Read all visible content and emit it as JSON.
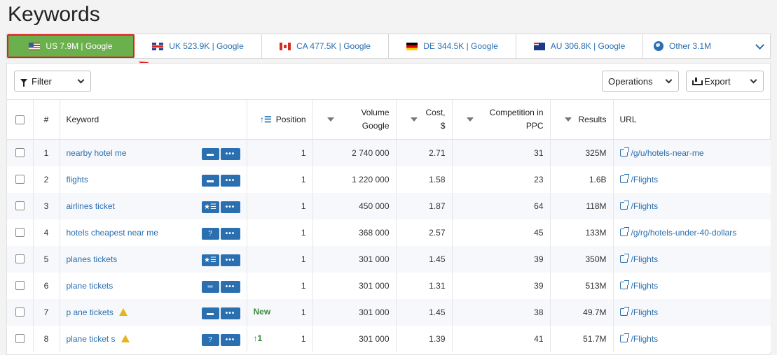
{
  "page": {
    "title": "Keywords"
  },
  "db_tabs": [
    {
      "label": "US 7.9M | Google",
      "flag": "us-flag-icon",
      "active": true
    },
    {
      "label": "UK 523.9K | Google",
      "flag": "uk-flag-icon",
      "active": false
    },
    {
      "label": "CA 477.5K | Google",
      "flag": "ca-flag-icon",
      "active": false
    },
    {
      "label": "DE 344.5K | Google",
      "flag": "de-flag-icon",
      "active": false
    },
    {
      "label": "AU 306.8K | Google",
      "flag": "au-flag-icon",
      "active": false
    },
    {
      "label": "Other 3.1M",
      "flag": "globe-icon",
      "active": false
    }
  ],
  "toolbar": {
    "filter_label": "Filter",
    "operations_label": "Operations",
    "export_label": "Export"
  },
  "table": {
    "headers": {
      "num": "#",
      "keyword": "Keyword",
      "position": "Position",
      "volume_1": "Volume",
      "volume_2": "Google",
      "cost_1": "Cost,",
      "cost_2": "$",
      "competition_1": "Competition in",
      "competition_2": "PPC",
      "results": "Results",
      "url": "URL"
    },
    "rows": [
      {
        "num": "1",
        "keyword": "nearby hotel me",
        "badge": "comment-icon",
        "change": "",
        "position": "1",
        "volume": "2 740 000",
        "cost": "2.71",
        "competition": "31",
        "results": "325M",
        "url": "/g/u/hotels-near-me"
      },
      {
        "num": "2",
        "keyword": "flights",
        "badge": "comment-icon",
        "change": "",
        "position": "1",
        "volume": "1 220 000",
        "cost": "1.58",
        "competition": "23",
        "results": "1.6B",
        "url": "/Flights"
      },
      {
        "num": "3",
        "keyword": "airlines ticket",
        "badge": "star-list-icon",
        "change": "",
        "position": "1",
        "volume": "450 000",
        "cost": "1.87",
        "competition": "64",
        "results": "118M",
        "url": "/Flights"
      },
      {
        "num": "4",
        "keyword": "hotels cheapest near me",
        "badge": "question-icon",
        "change": "",
        "position": "1",
        "volume": "368 000",
        "cost": "2.57",
        "competition": "45",
        "results": "133M",
        "url": "/g/rg/hotels-under-40-dollars"
      },
      {
        "num": "5",
        "keyword": "planes tickets",
        "badge": "star-list-icon",
        "change": "",
        "position": "1",
        "volume": "301 000",
        "cost": "1.45",
        "competition": "39",
        "results": "350M",
        "url": "/Flights"
      },
      {
        "num": "6",
        "keyword": "plane tickets",
        "badge": "snippet-icon",
        "change": "",
        "position": "1",
        "volume": "301 000",
        "cost": "1.31",
        "competition": "39",
        "results": "513M",
        "url": "/Flights"
      },
      {
        "num": "7",
        "keyword": "p ane tickets",
        "badge": "comment-icon",
        "warning": true,
        "change": "New",
        "position": "1",
        "volume": "301 000",
        "cost": "1.45",
        "competition": "38",
        "results": "49.7M",
        "url": "/Flights"
      },
      {
        "num": "8",
        "keyword": "plane ticket s",
        "badge": "question-icon",
        "warning": true,
        "change": "↑1",
        "position": "1",
        "volume": "301 000",
        "cost": "1.39",
        "competition": "41",
        "results": "51.7M",
        "url": "/Flights"
      }
    ],
    "more_icon": "•••"
  },
  "colors": {
    "active_tab": "#6ab04c",
    "highlight_border": "#e02020",
    "link": "#2a6fb0",
    "badge": "#2a6fb0",
    "new_tag": "#3a8a3a",
    "warning": "#e4b51d"
  }
}
